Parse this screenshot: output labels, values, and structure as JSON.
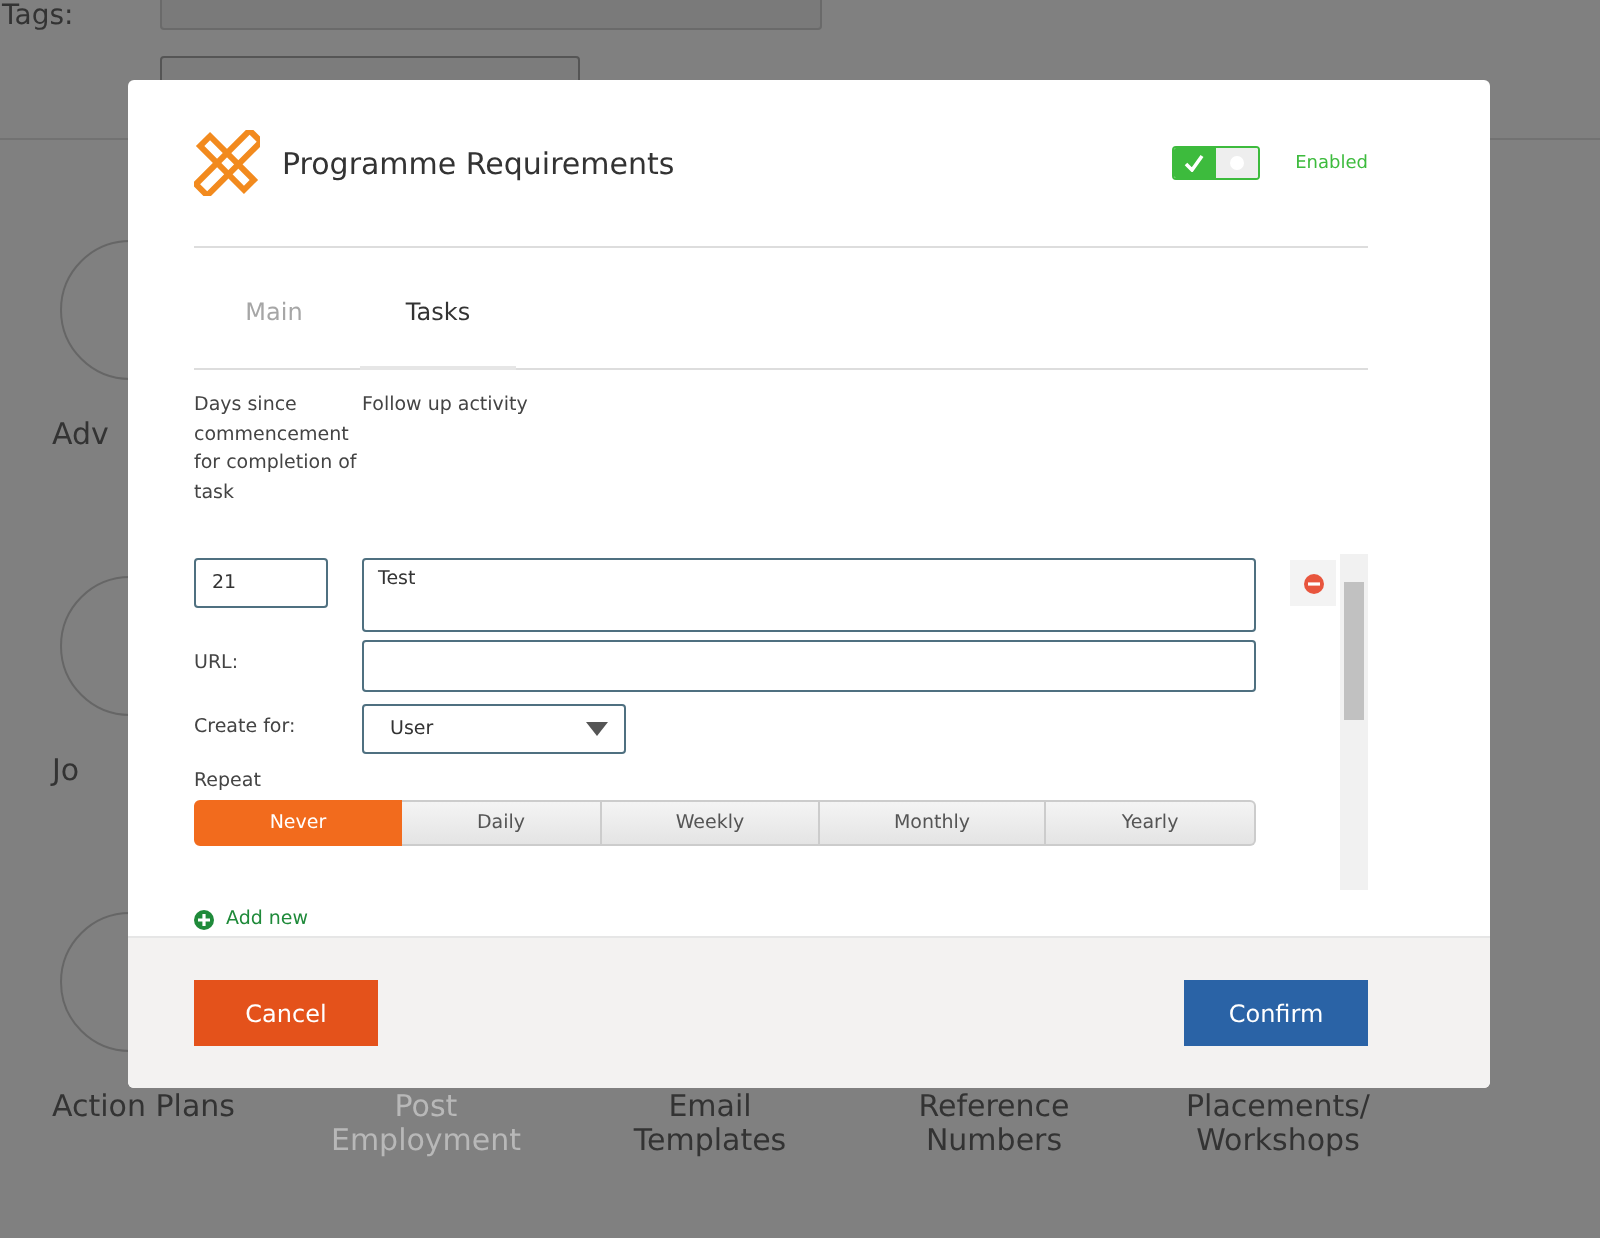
{
  "background": {
    "tags_label": "Tags:",
    "side_tiles": [
      {
        "label": "Adv"
      },
      {
        "label": "Jo"
      },
      {
        "label": "Action Plans"
      }
    ],
    "bottom_tiles": [
      {
        "label": "Post Employment",
        "disabled": true
      },
      {
        "label": "Email Templates",
        "disabled": false
      },
      {
        "label": "Reference Numbers",
        "disabled": false
      },
      {
        "label": "Placements/ Workshops",
        "disabled": false
      }
    ]
  },
  "dialog": {
    "title": "Programme Requirements",
    "enabled": {
      "on": true,
      "label": "Enabled"
    },
    "tabs": [
      {
        "label": "Main",
        "selected": false,
        "disabled": true
      },
      {
        "label": "Tasks",
        "selected": true,
        "disabled": false
      }
    ],
    "columns": [
      "Days since commencement for completion of task",
      "Follow up activity"
    ],
    "task": {
      "days": "21",
      "activity": "Test",
      "url_label": "URL:",
      "create_for_label": "Create for:",
      "create_for": "User",
      "repeat_label": "Repeat",
      "repeat": [
        {
          "label": "Never",
          "selected": true
        },
        {
          "label": "Daily",
          "selected": false
        },
        {
          "label": "Weekly",
          "selected": false
        },
        {
          "label": "Monthly",
          "selected": false
        },
        {
          "label": "Yearly",
          "selected": false
        }
      ]
    },
    "add_new": "Add new",
    "buttons": [
      {
        "label": "Cancel",
        "kind": "cancel"
      },
      {
        "label": "Confirm",
        "kind": "confirm"
      }
    ]
  }
}
